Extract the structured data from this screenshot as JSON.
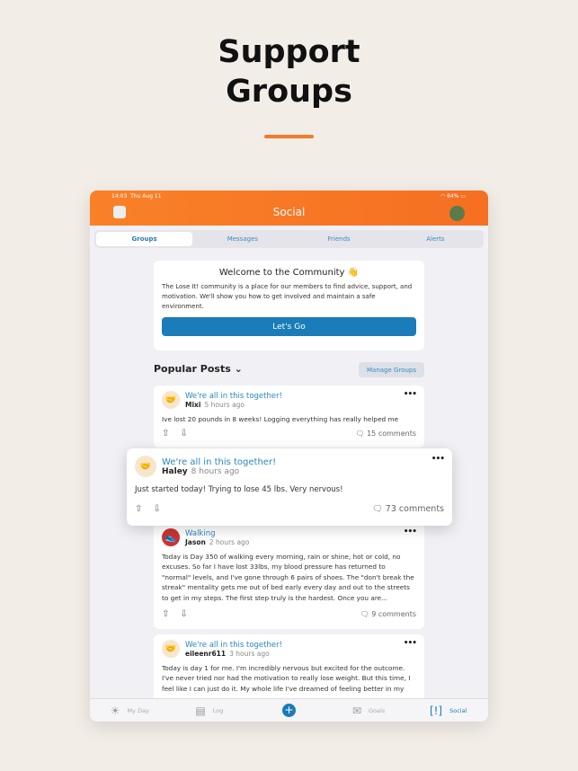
{
  "headline": [
    "Support",
    "Groups"
  ],
  "status": {
    "time": "14:03",
    "date": "Thu Aug 11",
    "battery": "64%"
  },
  "header": {
    "title": "Social"
  },
  "tabs": [
    "Groups",
    "Messages",
    "Friends",
    "Alerts"
  ],
  "welcome": {
    "title": "Welcome to the Community 👋",
    "text": "The Lose It! community is a place for our members to find advice, support, and motivation. We'll show you how to get involved and maintain a safe environment.",
    "button": "Let's Go"
  },
  "section": {
    "title": "Popular Posts ⌄",
    "manage": "Manage Groups"
  },
  "posts": [
    {
      "group": "We're all in this together!",
      "user": "Mixi",
      "time": "5 hours ago",
      "text": "Ive lost 20 pounds in 8 weeks! Logging everything has really helped me",
      "comments": "15 comments"
    },
    {
      "group": "We're all in this together!",
      "user": "Haley",
      "time": "8 hours ago",
      "text": "Just started today! Trying to lose 45 lbs. Very nervous!",
      "comments": "73 comments"
    },
    {
      "group": "Walking",
      "user": "Jason",
      "time": "2 hours ago",
      "text": "Today is Day 350 of walking every morning, rain or shine, hot or cold, no excuses.  So far I have lost 33lbs, my blood pressure has returned to \"normal\" levels, and I've gone through 6 pairs of shoes.  The \"don't break the streak\" mentality gets me out of bed early every day and out to the streets to get in my steps.  The first step truly is the hardest.  Once you are...",
      "comments": "9 comments"
    },
    {
      "group": "We're all in this together!",
      "user": "eileenr611",
      "time": "3 hours ago",
      "text": "Today is day 1 for me. I'm incredibly nervous but excited for the outcome. I've never tried nor had the motivation to really lose weight. But this time, I feel like I can just do it. My whole life I've dreamed of feeling better in my"
    }
  ],
  "tabbar": [
    "My Day",
    "Log",
    "Goals",
    "Social"
  ],
  "colors": {
    "brand": "#f97a2a",
    "accent": "#1a7cb8"
  }
}
